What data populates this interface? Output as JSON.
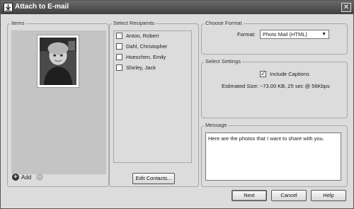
{
  "window": {
    "title": "Attach to E-mail",
    "close_glyph": "✕"
  },
  "items": {
    "label": "Items",
    "add_label": "Add",
    "add_glyph": "+",
    "remove_glyph": "−"
  },
  "recipients": {
    "label": "Select Recipients",
    "list": [
      {
        "name": "Anton, Robert",
        "checked": false
      },
      {
        "name": "Dahl, Christopher",
        "checked": false
      },
      {
        "name": "Hoeschen, Emily",
        "checked": false
      },
      {
        "name": "Shirley, Jack",
        "checked": false
      }
    ],
    "edit_contacts_label": "Edit Contacts..."
  },
  "format": {
    "label": "Choose Format",
    "field_label": "Format:",
    "selected": "Photo Mail (HTML)",
    "arrow_glyph": "▼"
  },
  "settings": {
    "label": "Select Settings",
    "include_captions_label": "Include Captions",
    "include_captions_checked": true,
    "estimated_size_label": "Estimated Size:",
    "estimated_size_value": "~73.00 KB, 25 sec @ 56Kbps"
  },
  "message": {
    "label": "Message",
    "text": "Here are the photos that I want to share with you."
  },
  "buttons": {
    "next": "Next",
    "cancel": "Cancel",
    "help": "Help"
  }
}
